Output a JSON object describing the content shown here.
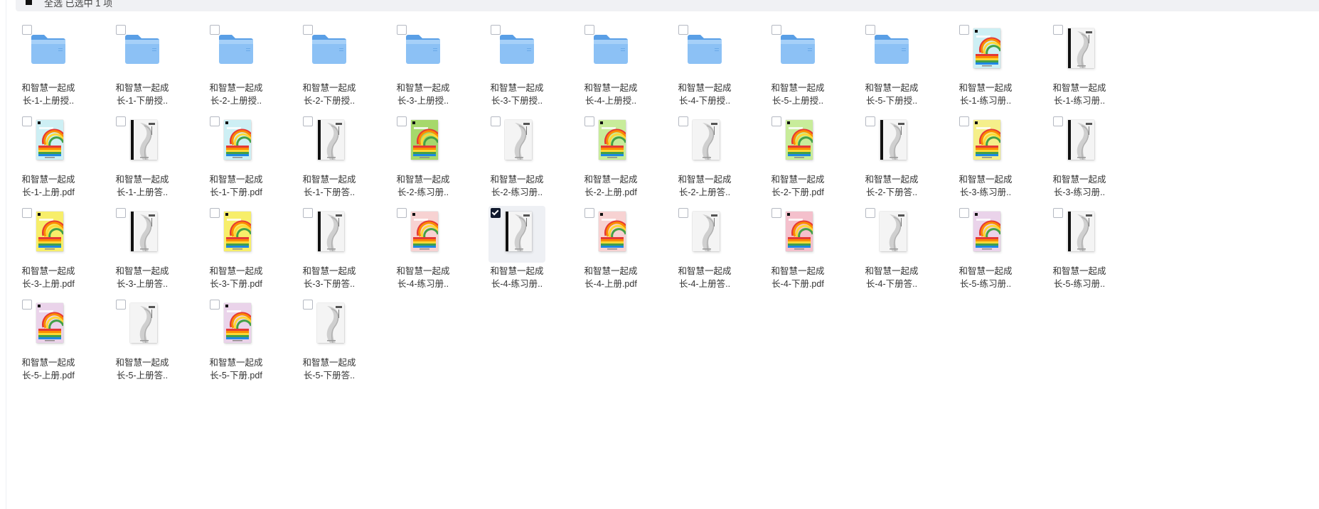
{
  "toolbar": {
    "select_all_text": "全选 已选中 1 项"
  },
  "files": [
    {
      "line1": "和智慧一起成",
      "line2": "长-1-上册授..",
      "kind": "folder",
      "cover": "#4a90e2"
    },
    {
      "line1": "和智慧一起成",
      "line2": "长-1-下册授..",
      "kind": "folder",
      "cover": "#4a90e2"
    },
    {
      "line1": "和智慧一起成",
      "line2": "长-2-上册授..",
      "kind": "folder",
      "cover": "#4a90e2"
    },
    {
      "line1": "和智慧一起成",
      "line2": "长-2-下册授..",
      "kind": "folder",
      "cover": "#4a90e2"
    },
    {
      "line1": "和智慧一起成",
      "line2": "长-3-上册授..",
      "kind": "folder",
      "cover": "#4a90e2"
    },
    {
      "line1": "和智慧一起成",
      "line2": "长-3-下册授..",
      "kind": "folder",
      "cover": "#4a90e2"
    },
    {
      "line1": "和智慧一起成",
      "line2": "长-4-上册授..",
      "kind": "folder",
      "cover": "#4a90e2"
    },
    {
      "line1": "和智慧一起成",
      "line2": "长-4-下册授..",
      "kind": "folder",
      "cover": "#4a90e2"
    },
    {
      "line1": "和智慧一起成",
      "line2": "长-5-上册授..",
      "kind": "folder",
      "cover": "#4a90e2"
    },
    {
      "line1": "和智慧一起成",
      "line2": "长-5-下册授..",
      "kind": "folder",
      "cover": "#4a90e2"
    },
    {
      "line1": "和智慧一起成",
      "line2": "长-1-练习册..",
      "kind": "rainbow",
      "cover": "#cdeff4"
    },
    {
      "line1": "和智慧一起成",
      "line2": "长-1-练习册..",
      "kind": "answer-dark",
      "cover": "#e8e8e8"
    },
    {
      "line1": "和智慧一起成",
      "line2": "长-1-上册.pdf",
      "kind": "rainbow",
      "cover": "#cdeff4"
    },
    {
      "line1": "和智慧一起成",
      "line2": "长-1-上册答..",
      "kind": "answer-dark",
      "cover": "#e8e8e8"
    },
    {
      "line1": "和智慧一起成",
      "line2": "长-1-下册.pdf",
      "kind": "rainbow",
      "cover": "#cdeff4"
    },
    {
      "line1": "和智慧一起成",
      "line2": "长-1-下册答..",
      "kind": "answer-dark",
      "cover": "#e8e8e8"
    },
    {
      "line1": "和智慧一起成",
      "line2": "长-2-练习册..",
      "kind": "rainbow",
      "cover": "#a6d86b"
    },
    {
      "line1": "和智慧一起成",
      "line2": "长-2-练习册..",
      "kind": "answer",
      "cover": "#e8e8e8"
    },
    {
      "line1": "和智慧一起成",
      "line2": "长-2-上册.pdf",
      "kind": "rainbow",
      "cover": "#c8ec9a"
    },
    {
      "line1": "和智慧一起成",
      "line2": "长-2-上册答..",
      "kind": "answer",
      "cover": "#e8e8e8"
    },
    {
      "line1": "和智慧一起成",
      "line2": "长-2-下册.pdf",
      "kind": "rainbow",
      "cover": "#c8ec9a"
    },
    {
      "line1": "和智慧一起成",
      "line2": "长-2-下册答..",
      "kind": "answer-dark",
      "cover": "#e8e8e8"
    },
    {
      "line1": "和智慧一起成",
      "line2": "长-3-练习册..",
      "kind": "rainbow",
      "cover": "#f5ef8a"
    },
    {
      "line1": "和智慧一起成",
      "line2": "长-3-练习册..",
      "kind": "answer-dark",
      "cover": "#e8e8e8"
    },
    {
      "line1": "和智慧一起成",
      "line2": "长-3-上册.pdf",
      "kind": "rainbow",
      "cover": "#f7ee6a"
    },
    {
      "line1": "和智慧一起成",
      "line2": "长-3-上册答..",
      "kind": "answer-dark",
      "cover": "#e8e8e8"
    },
    {
      "line1": "和智慧一起成",
      "line2": "长-3-下册.pdf",
      "kind": "rainbow",
      "cover": "#f7ee6a"
    },
    {
      "line1": "和智慧一起成",
      "line2": "长-3-下册答..",
      "kind": "answer-dark",
      "cover": "#e8e8e8"
    },
    {
      "line1": "和智慧一起成",
      "line2": "长-4-练习册..",
      "kind": "rainbow",
      "cover": "#f7d2d2"
    },
    {
      "line1": "和智慧一起成",
      "line2": "长-4-练习册..",
      "kind": "answer-dark",
      "cover": "#e8e8e8",
      "selected": true
    },
    {
      "line1": "和智慧一起成",
      "line2": "长-4-上册.pdf",
      "kind": "rainbow",
      "cover": "#f7d2d2"
    },
    {
      "line1": "和智慧一起成",
      "line2": "长-4-上册答..",
      "kind": "answer",
      "cover": "#e8e8e8"
    },
    {
      "line1": "和智慧一起成",
      "line2": "长-4-下册.pdf",
      "kind": "rainbow",
      "cover": "#f4c0cc"
    },
    {
      "line1": "和智慧一起成",
      "line2": "长-4-下册答..",
      "kind": "answer",
      "cover": "#e8e8e8"
    },
    {
      "line1": "和智慧一起成",
      "line2": "长-5-练习册..",
      "kind": "rainbow",
      "cover": "#ead3ea"
    },
    {
      "line1": "和智慧一起成",
      "line2": "长-5-练习册..",
      "kind": "answer-dark",
      "cover": "#e8e8e8"
    },
    {
      "line1": "和智慧一起成",
      "line2": "长-5-上册.pdf",
      "kind": "rainbow",
      "cover": "#ead3ea"
    },
    {
      "line1": "和智慧一起成",
      "line2": "长-5-上册答..",
      "kind": "answer",
      "cover": "#e8e8e8"
    },
    {
      "line1": "和智慧一起成",
      "line2": "长-5-下册.pdf",
      "kind": "rainbow",
      "cover": "#ead3ea"
    },
    {
      "line1": "和智慧一起成",
      "line2": "长-5-下册答..",
      "kind": "answer",
      "cover": "#e8e8e8"
    }
  ]
}
